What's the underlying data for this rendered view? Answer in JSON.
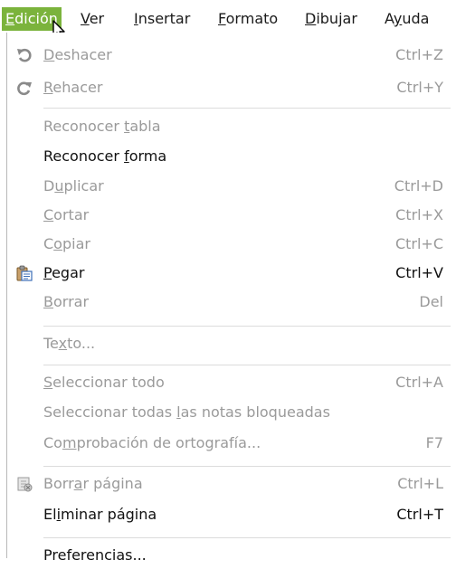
{
  "menubar": {
    "items": [
      {
        "pre": "",
        "u": "E",
        "post": "dición"
      },
      {
        "pre": "",
        "u": "V",
        "post": "er"
      },
      {
        "pre": "",
        "u": "I",
        "post": "nsertar"
      },
      {
        "pre": "",
        "u": "F",
        "post": "ormato"
      },
      {
        "pre": "",
        "u": "D",
        "post": "ibujar"
      },
      {
        "pre": "A",
        "u": "y",
        "post": "uda"
      }
    ]
  },
  "menu": {
    "items": [
      {
        "pre": "",
        "u": "D",
        "post": "eshacer",
        "accel": "Ctrl+Z"
      },
      {
        "pre": "",
        "u": "R",
        "post": "ehacer",
        "accel": "Ctrl+Y"
      },
      {
        "pre": "Reconocer ",
        "u": "t",
        "post": "abla",
        "accel": ""
      },
      {
        "pre": "Reconocer ",
        "u": "f",
        "post": "orma",
        "accel": ""
      },
      {
        "pre": "D",
        "u": "u",
        "post": "plicar",
        "accel": "Ctrl+D"
      },
      {
        "pre": "",
        "u": "C",
        "post": "ortar",
        "accel": "Ctrl+X"
      },
      {
        "pre": "C",
        "u": "o",
        "post": "piar",
        "accel": "Ctrl+C"
      },
      {
        "pre": "",
        "u": "P",
        "post": "egar",
        "accel": "Ctrl+V"
      },
      {
        "pre": "",
        "u": "B",
        "post": "orrar",
        "accel": "Del"
      },
      {
        "pre": "Te",
        "u": "x",
        "post": "to...",
        "accel": ""
      },
      {
        "pre": "",
        "u": "S",
        "post": "eleccionar todo",
        "accel": "Ctrl+A"
      },
      {
        "pre": "Seleccionar todas ",
        "u": "l",
        "post": "as notas bloqueadas",
        "accel": ""
      },
      {
        "pre": "Co",
        "u": "m",
        "post": "probación de ortografía...",
        "accel": "F7"
      },
      {
        "pre": "Borr",
        "u": "a",
        "post": "r página",
        "accel": "Ctrl+L"
      },
      {
        "pre": "El",
        "u": "i",
        "post": "minar página",
        "accel": "Ctrl+T"
      },
      {
        "pre": "Preferencias...",
        "u": "",
        "post": "",
        "accel": ""
      }
    ]
  },
  "colors": {
    "active_menu": "#7bb33c",
    "disabled_text": "#9a9a9a"
  },
  "icons": [
    "undo-icon",
    "redo-icon",
    "paste-icon",
    "delete-page-icon",
    "mouse-pointer-icon"
  ]
}
